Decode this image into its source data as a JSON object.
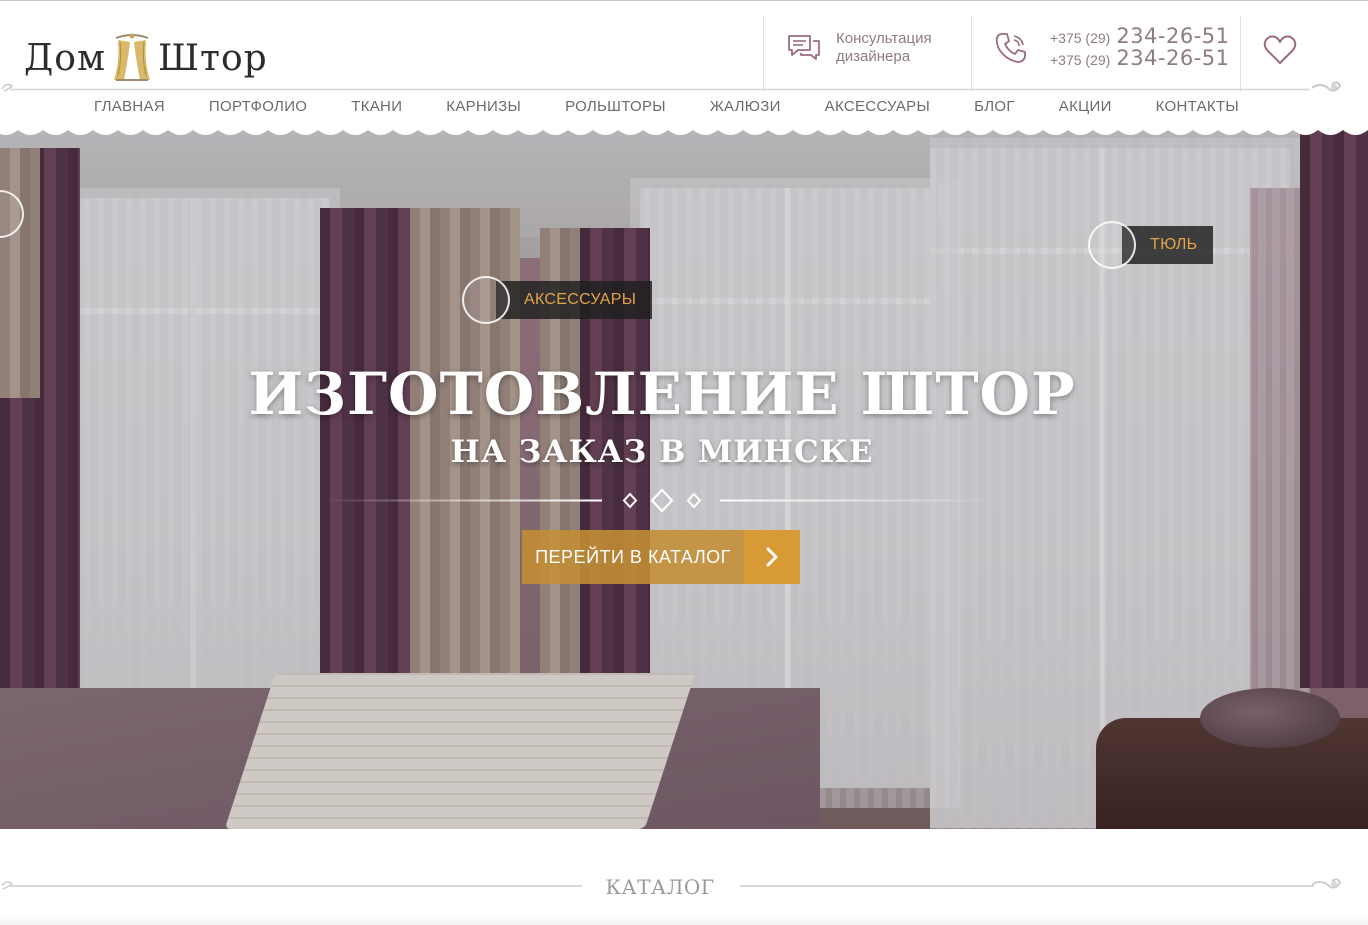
{
  "logo": {
    "word_left": "Дом",
    "word_right": "Штор"
  },
  "header": {
    "consult": {
      "line1": "Консультация",
      "line2": "дизайнера"
    },
    "phones": [
      {
        "code": "+375 (29)",
        "number": "234-26-51"
      },
      {
        "code": "+375 (29)",
        "number": "234-26-51"
      }
    ]
  },
  "nav": {
    "items": [
      "ГЛАВНАЯ",
      "ПОРТФОЛИО",
      "ТКАНИ",
      "КАРНИЗЫ",
      "РОЛЬШТОРЫ",
      "ЖАЛЮЗИ",
      "АКСЕССУАРЫ",
      "БЛОГ",
      "АКЦИИ",
      "КОНТАКТЫ"
    ]
  },
  "hero": {
    "title": "ИЗГОТОВЛЕНИЕ ШТОР",
    "subtitle": "НА ЗАКАЗ В МИНСКЕ",
    "hotspots": {
      "accessories": "АКСЕССУАРЫ",
      "tulle": "ТЮЛЬ"
    },
    "cta_label": "ПЕРЕЙТИ В КАТАЛОГ"
  },
  "catalog": {
    "title": "КАТАЛОГ"
  },
  "colors": {
    "accent_gold": "#d89a34",
    "tag_text": "#e3a34a",
    "header_text": "#8e7b86",
    "icon_plum": "#9b6b83"
  },
  "icons": [
    "logo-curtain-icon",
    "chat-icon",
    "phone-icon",
    "heart-icon",
    "chevron-right-icon",
    "diamond-ornament-icon",
    "swirl-ornament-icon"
  ]
}
